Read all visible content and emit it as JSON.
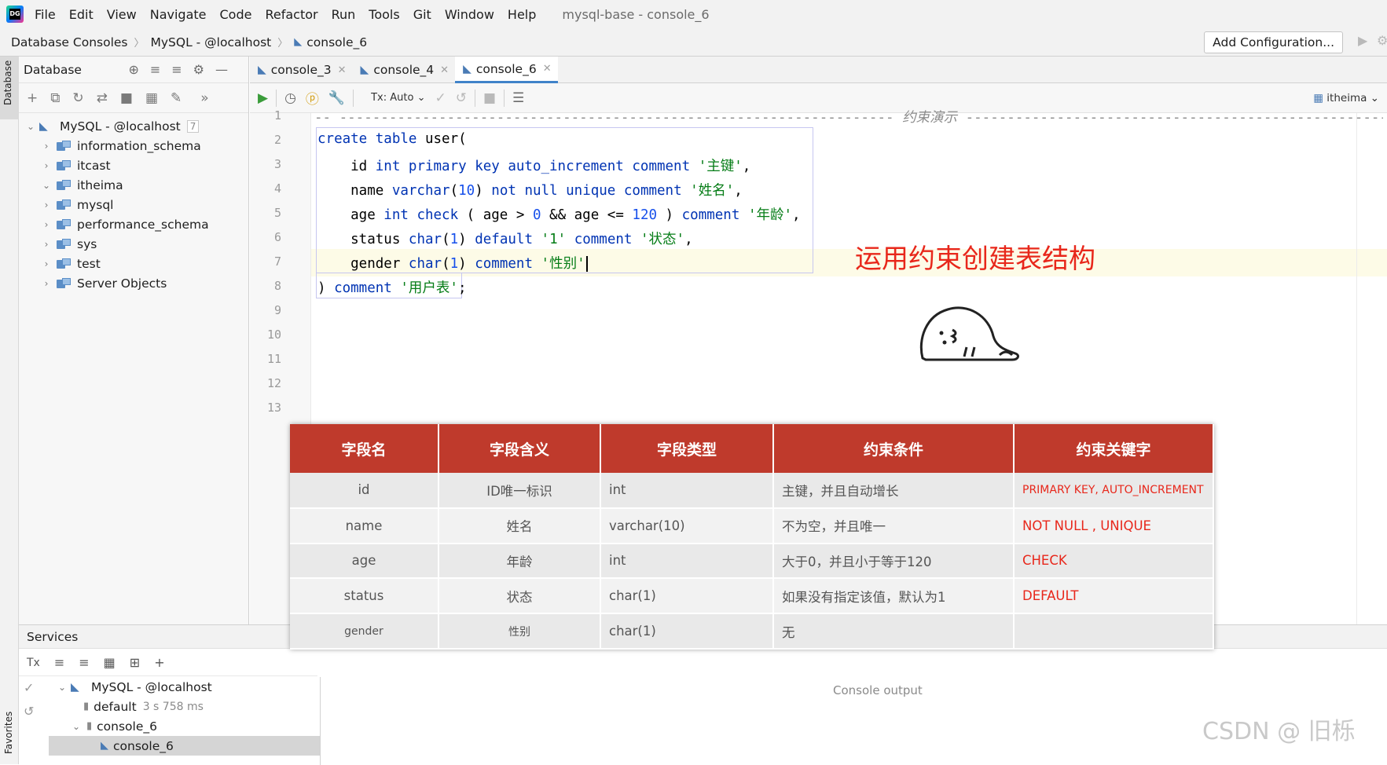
{
  "menu": {
    "items": [
      "File",
      "Edit",
      "View",
      "Navigate",
      "Code",
      "Refactor",
      "Run",
      "Tools",
      "Git",
      "Window",
      "Help"
    ],
    "window_title": "mysql-base - console_6"
  },
  "breadcrumb": {
    "items": [
      "Database Consoles",
      "MySQL - @localhost",
      "console_6"
    ],
    "add_configuration": "Add Configuration..."
  },
  "stripe": {
    "database": "Database",
    "favorites": "Favorites"
  },
  "database_panel": {
    "title": "Database",
    "root": {
      "label": "MySQL - @localhost",
      "count": "7"
    },
    "schemas": [
      "information_schema",
      "itcast",
      "itheima",
      "mysql",
      "performance_schema",
      "sys",
      "test"
    ],
    "server_objects": "Server Objects"
  },
  "tabs": [
    {
      "label": "console_3"
    },
    {
      "label": "console_4"
    },
    {
      "label": "console_6",
      "active": true
    }
  ],
  "editor_toolbar": {
    "tx_mode": "Tx: Auto",
    "schema": "itheima"
  },
  "editor": {
    "line_numbers": [
      "1",
      "2",
      "3",
      "4",
      "5",
      "6",
      "7",
      "8",
      "9",
      "10",
      "11",
      "12",
      "13"
    ],
    "comment_label": "约束演示",
    "code": {
      "l2_kw": "create table",
      "l2_rest": " user(",
      "l3_a": "    id ",
      "l3_kw": "int primary key auto_increment comment",
      "l3_str": "'主键'",
      "l3_end": ",",
      "l4_a": "    name ",
      "l4_kw": "varchar",
      "l4_num": "10",
      "l4_kw2": "not null unique comment",
      "l4_str": "'姓名'",
      "l4_end": ",",
      "l5_a": "    age ",
      "l5_kw": "int check",
      "l5_b": " ( age > ",
      "l5_num": "0",
      "l5_c": " && age <= ",
      "l5_num2": "120",
      "l5_d": " ) ",
      "l5_kw2": "comment",
      "l5_str": "'年龄'",
      "l5_end": ",",
      "l6_a": "    status ",
      "l6_kw": "char",
      "l6_num": "1",
      "l6_kw2": "default",
      "l6_str": "'1'",
      "l6_kw3": "comment",
      "l6_str2": "'状态'",
      "l6_end": ",",
      "l7_a": "    gender ",
      "l7_kw": "char",
      "l7_num": "1",
      "l7_kw2": "comment",
      "l7_str": "'性别'",
      "l8_a": ") ",
      "l8_kw": "comment",
      "l8_str": "'用户表'",
      "l8_end": ";"
    }
  },
  "overlay": {
    "title": "运用约束创建表结构",
    "table": {
      "headers": [
        "字段名",
        "字段含义",
        "字段类型",
        "约束条件",
        "约束关键字"
      ],
      "rows": [
        [
          "id",
          "ID唯一标识",
          "int",
          "主键，并且自动增长",
          "PRIMARY KEY, AUTO_INCREMENT"
        ],
        [
          "name",
          "姓名",
          "varchar(10)",
          "不为空，并且唯一",
          "NOT  NULL , UNIQUE"
        ],
        [
          "age",
          "年龄",
          "int",
          "大于0，并且小于等于120",
          "CHECK"
        ],
        [
          "status",
          "状态",
          "char(1)",
          "如果没有指定该值，默认为1",
          "DEFAULT"
        ],
        [
          "gender",
          "性别",
          "char(1)",
          "无",
          ""
        ]
      ]
    }
  },
  "services": {
    "title": "Services",
    "tree": {
      "root": "MySQL - @localhost",
      "default_label": "default",
      "default_time": "3 s 758 ms",
      "console_group": "console_6",
      "console_leaf": "console_6"
    },
    "console_output": "Console output"
  },
  "watermark": "CSDN @ 旧栎",
  "colors": {
    "accent_red": "#bf3a2c",
    "title_red": "#e8271b",
    "keyword": "#0033b3",
    "string": "#067d17"
  }
}
